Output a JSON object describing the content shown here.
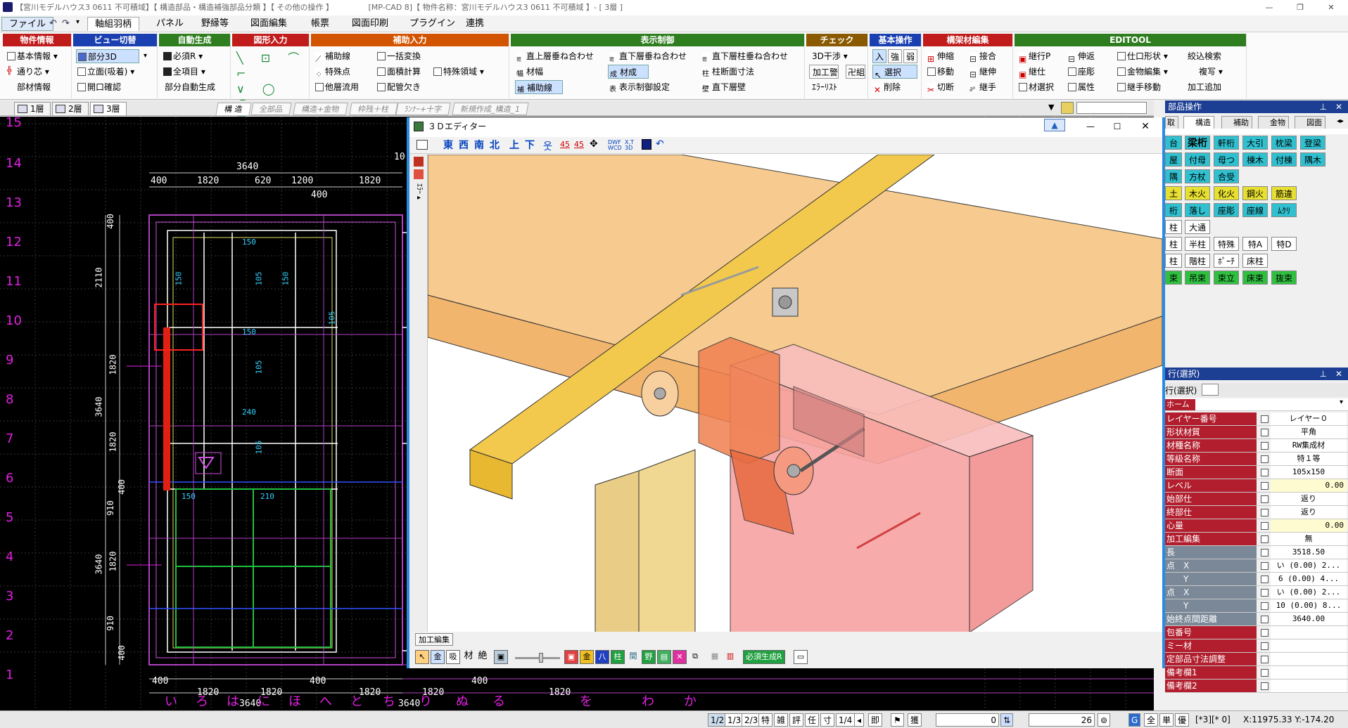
{
  "window": {
    "title": "【宮川モデルハウス3 0611 不可積域】【 構造部品・構造補強部品分類 】【 その他の操作 】　　　　　[MP-CAD 8]【 物件名称：宮川モデルハウス3 0611 不可積域 】- [ 3層 ]"
  },
  "menu": [
    "ファイル",
    "軸組羽柄",
    "パネル",
    "野縁等",
    "図面編集",
    "帳票",
    "図面印刷",
    "プラグイン",
    "連携"
  ],
  "ribbon": {
    "groups": [
      {
        "title": "物件情報",
        "color": "#c01c1c",
        "items": [
          "基本情報",
          "通り芯",
          "部材情報"
        ]
      },
      {
        "title": "ビュー切替",
        "color": "#1a3fb0",
        "items": [
          "部分3D",
          "立面(吸着)",
          "開口確認"
        ]
      },
      {
        "title": "自動生成",
        "color": "#2e7d1e",
        "items": [
          "必須R",
          "全項目",
          "部分自動生成"
        ]
      },
      {
        "title": "図形入力",
        "color": "#c01c1c",
        "items": []
      },
      {
        "title": "補助入力",
        "color": "#d35400",
        "items": [
          "補助線",
          "特殊点",
          "他層流用",
          "一括変換",
          "面積計算",
          "配管欠き",
          "特殊領域"
        ]
      },
      {
        "title": "表示制御",
        "color": "#2e7d1e",
        "items": [
          "直上層垂ね合わせ",
          "材幅",
          "補助線",
          "直下層垂ね合わせ",
          "材成",
          "表示制御設定",
          "直下層柱垂ね合わせ",
          "柱断面寸法",
          "直下層壁"
        ]
      },
      {
        "title": "チェック",
        "color": "#8a5a00",
        "items": [
          "3D干渉",
          "加工警",
          "卍組",
          "ｴﾗｰﾘｽﾄ"
        ]
      },
      {
        "title": "基本操作",
        "color": "#1a3fb0",
        "items": [
          "入",
          "強",
          "弱",
          "選択",
          "削除"
        ]
      },
      {
        "title": "構架材編集",
        "color": "#c01c1c",
        "items": [
          "伸縮",
          "移動",
          "切断",
          "接合",
          "継伸",
          "継手"
        ]
      },
      {
        "title": "EDITOOL",
        "color": "#2e7d1e",
        "items": [
          "継行P",
          "継仕",
          "材選択",
          "伸返",
          "座彫",
          "属性",
          "仕口形状",
          "金物編集",
          "継手移動",
          "絞込検索",
          "複写",
          "加工追加"
        ]
      }
    ]
  },
  "layer_tabs": [
    "1層",
    "2層",
    "3層"
  ],
  "category_tabs": [
    "構 造",
    "全部品",
    "構造+金物",
    "枠残＋柱",
    "ﾗﾝﾅｰ+十字",
    "新規作成_構造_1"
  ],
  "cad": {
    "row_numbers": [
      "15",
      "14",
      "13",
      "12",
      "11",
      "10",
      "9",
      "8",
      "7",
      "6",
      "5",
      "4",
      "3",
      "2",
      "1"
    ],
    "top_dims": [
      "400",
      "1820",
      "620",
      "1200",
      "1820",
      "3640",
      "400",
      "10"
    ],
    "bottom_dims": [
      "400",
      "1820",
      "1820",
      "400",
      "1820",
      "3640",
      "1820",
      "3640",
      "1820",
      "400"
    ],
    "left_dims": [
      "400",
      "2110",
      "1820",
      "3640",
      "1820",
      "400",
      "910",
      "1820",
      "3640",
      "910",
      "400"
    ],
    "inner_dims": [
      "150",
      "105",
      "150",
      "150",
      "105",
      "105",
      "150",
      "240",
      "105",
      "150",
      "210"
    ],
    "bottom_kana": [
      "い",
      "ろ",
      "は",
      "に",
      "ほ",
      "へ",
      "と",
      "ち",
      "り",
      "ぬ",
      "る",
      "を",
      "わ",
      "か"
    ]
  },
  "editor": {
    "title": "３Ｄエディター",
    "directions": [
      "東",
      "西",
      "南",
      "北",
      "上",
      "下"
    ],
    "bottom_tab": "加工編集",
    "bottom_buttons": [
      "金",
      "吸",
      "材",
      "絶"
    ],
    "generate_button": "必須生成R"
  },
  "parts_panel": {
    "title": "部品操作",
    "tabs": [
      "取",
      "構造",
      "補助",
      "金物",
      "図面"
    ],
    "grid": [
      [
        "台",
        "梁桁",
        "軒桁",
        "大引",
        "枕梁",
        "登梁"
      ],
      [
        "屋",
        "付母",
        "母つ",
        "棟木",
        "付棟",
        "隅木"
      ],
      [
        "隅",
        "方杖",
        "合受"
      ],
      [
        "土",
        "木火",
        "化火",
        "鋼火",
        "筋違"
      ],
      [
        "桁",
        "落し",
        "座彫",
        "座線",
        "ﾑｸﾘ"
      ],
      [
        "柱",
        "大通"
      ],
      [
        "柱",
        "半柱",
        "特殊",
        "特A",
        "特D"
      ],
      [
        "柱",
        "階柱",
        "ﾎﾟｰﾁ",
        "床柱"
      ],
      [
        "束",
        "吊束",
        "束立",
        "床束",
        "抜束"
      ]
    ]
  },
  "props_panel": {
    "title": "行(選択)",
    "subtitle": "行(選択)",
    "tab": "ホーム",
    "rows": [
      {
        "key": "レイヤー番号",
        "value": "レイヤー０",
        "style": "red"
      },
      {
        "key": "形状材質",
        "value": "平角",
        "style": "red"
      },
      {
        "key": "材種名称",
        "value": "RW集成材",
        "style": "red"
      },
      {
        "key": "等級名称",
        "value": "特１等",
        "style": "red"
      },
      {
        "key": "断面",
        "value": "105x150",
        "style": "red"
      },
      {
        "key": "レベル",
        "value": "0.00",
        "style": "yellow"
      },
      {
        "key": "始部仕",
        "value": "返り",
        "style": "red"
      },
      {
        "key": "終部仕",
        "value": "返り",
        "style": "red"
      },
      {
        "key": "心量",
        "value": "0.00",
        "style": "yellow"
      },
      {
        "key": "加工編集",
        "value": "無",
        "style": "red"
      },
      {
        "key": "長",
        "value": "3518.50",
        "style": "grey"
      },
      {
        "key": "点　X",
        "value": "い (0.00) 2...",
        "style": "grey"
      },
      {
        "key": "　　Y",
        "value": "6 (0.00) 4...",
        "style": "grey"
      },
      {
        "key": "点　X",
        "value": "い (0.00) 2...",
        "style": "grey"
      },
      {
        "key": "　　Y",
        "value": "10 (0.00) 8...",
        "style": "grey"
      },
      {
        "key": "始終点間距離",
        "value": "3640.00",
        "style": "grey"
      },
      {
        "key": "包番号",
        "value": "",
        "style": "red"
      },
      {
        "key": "ミー材",
        "value": "",
        "style": "red"
      },
      {
        "key": "定部品寸法調整",
        "value": "",
        "style": "red"
      },
      {
        "key": "備考欄1",
        "value": "",
        "style": "red"
      },
      {
        "key": "備考欄2",
        "value": "",
        "style": "red"
      }
    ]
  },
  "statusbar": {
    "modes": [
      "1/2",
      "1/3",
      "2/3",
      "特",
      "雑",
      "評",
      "任",
      "寸",
      "1/4"
    ],
    "tool_labels": [
      "即",
      "獲"
    ],
    "input1": "0",
    "input2": "26",
    "flags": [
      "全",
      "単",
      "優"
    ],
    "layer_info": "[*3][* 0]",
    "coords": "X:11975.33  Y:-174.20"
  }
}
